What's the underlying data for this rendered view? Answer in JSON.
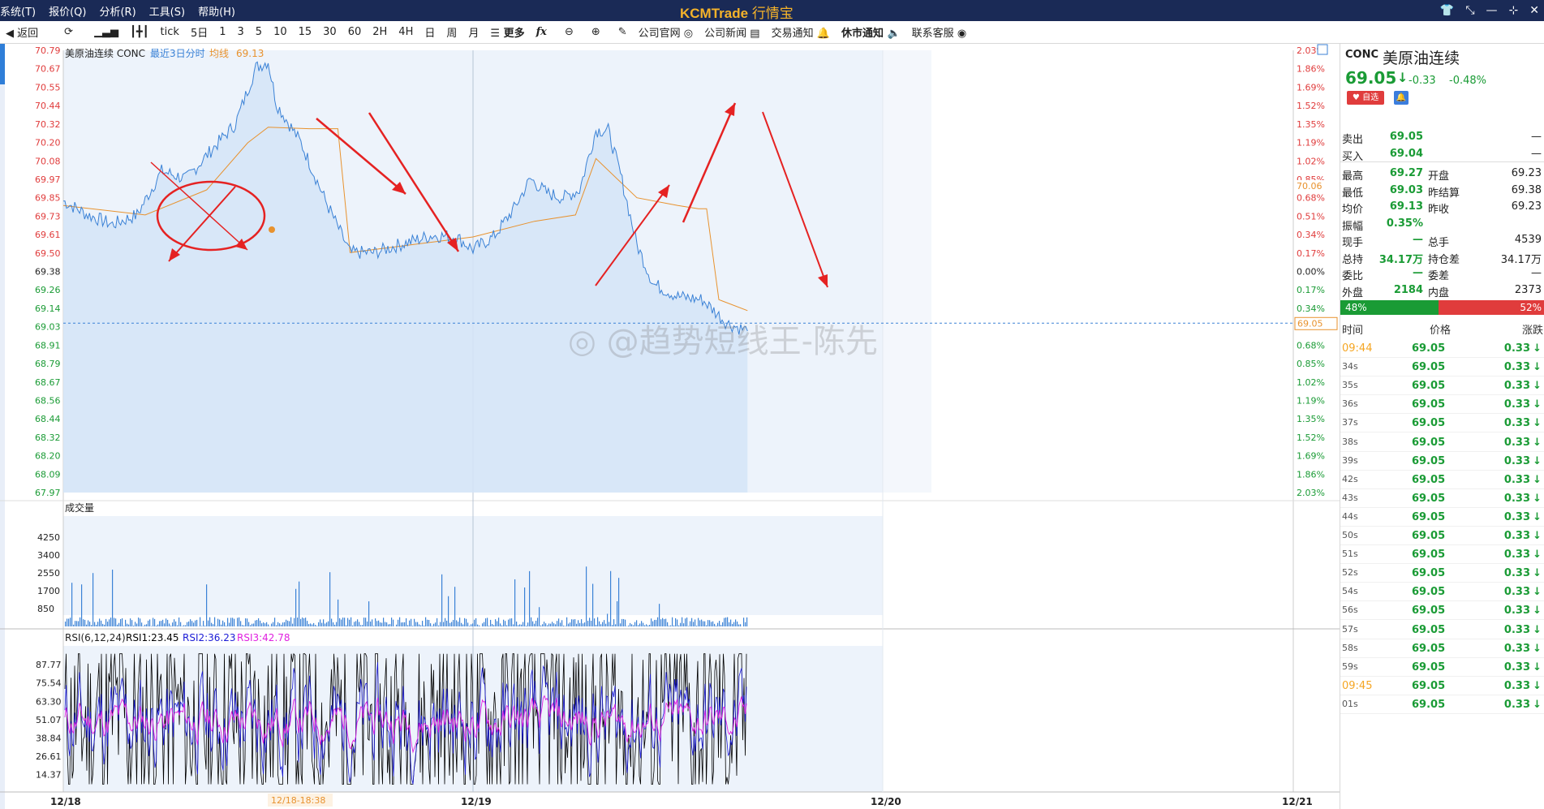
{
  "app": {
    "menu": [
      "系统(T)",
      "报价(Q)",
      "分析(R)",
      "工具(S)",
      "帮助(H)"
    ],
    "brand": "KCMTrade",
    "brand_cn": "行情宝",
    "window_controls": [
      "shirt-icon",
      "shrink-icon",
      "minimize-icon",
      "restore-icon",
      "close-icon"
    ]
  },
  "toolbar": {
    "back": "返回",
    "periods": [
      "tick",
      "5日",
      "1",
      "3",
      "5",
      "10",
      "15",
      "30",
      "60",
      "2H",
      "4H",
      "日",
      "周",
      "月"
    ],
    "more": "更多",
    "links": [
      "公司官网",
      "公司新闻",
      "交易通知",
      "休市通知",
      "联系客服"
    ]
  },
  "chart": {
    "title": "美原油连续 CONC",
    "subtitle": "最近3日分时",
    "avg_label": "均线",
    "avg_value": "69.13",
    "price_ticks": [
      "70.79",
      "70.67",
      "70.55",
      "70.44",
      "70.32",
      "70.20",
      "70.08",
      "69.97",
      "69.85",
      "69.73",
      "69.61",
      "69.50",
      "69.38",
      "69.26",
      "69.14",
      "69.03",
      "68.91",
      "68.79",
      "68.67",
      "68.56",
      "68.44",
      "68.32",
      "68.20",
      "68.09",
      "67.97"
    ],
    "pct_ticks": [
      "2.03%",
      "1.86%",
      "1.69%",
      "1.52%",
      "1.35%",
      "1.19%",
      "1.02%",
      "0.85%",
      "0.68%",
      "0.51%",
      "0.34%",
      "0.17%",
      "0.00%",
      "0.17%",
      "0.34%",
      "0.51%",
      "0.68%",
      "0.85%",
      "1.02%",
      "1.19%",
      "1.35%",
      "1.52%",
      "1.69%",
      "1.86%",
      "2.03%"
    ],
    "avg_right_label": "70.06",
    "current_label": "69.05",
    "volume_title": "成交量",
    "volume_ticks": [
      "4250",
      "3400",
      "2550",
      "1700",
      "850"
    ],
    "rsi_title": "RSI(6,12,24)",
    "rsi1": "RSI1:23.45",
    "rsi2": "RSI2:36.23",
    "rsi3": "RSI3:42.78",
    "rsi_ticks": [
      "87.77",
      "75.54",
      "63.30",
      "51.07",
      "38.84",
      "26.61",
      "14.37"
    ],
    "x_labels": [
      "12/18",
      "12/19",
      "12/20",
      "12/21"
    ],
    "cursor_time": "12/18-18:38",
    "watermark": "@趋势短线王-陈先",
    "colors": {
      "price_line": "#3b82d6",
      "avg_line": "#e8922e",
      "annotation": "#e52222",
      "rsi1": "#000000",
      "rsi2": "#1b1bd6",
      "rsi3": "#e020e0"
    }
  },
  "chart_data": {
    "type": "line",
    "title": "美原油连续 CONC",
    "x_labels": [
      "12/18",
      "12/19",
      "12/20",
      "12/21"
    ],
    "ylim": [
      67.97,
      70.79
    ],
    "prev_settle": 69.38,
    "series": [
      {
        "name": "价格",
        "points": [
          [
            0,
            69.83
          ],
          [
            0.06,
            69.74
          ],
          [
            0.12,
            69.68
          ],
          [
            0.18,
            69.74
          ],
          [
            0.24,
            70.02
          ],
          [
            0.3,
            69.97
          ],
          [
            0.36,
            70.15
          ],
          [
            0.42,
            70.32
          ],
          [
            0.47,
            70.68
          ],
          [
            0.5,
            70.72
          ],
          [
            0.52,
            70.45
          ],
          [
            0.58,
            70.2
          ],
          [
            0.64,
            69.83
          ],
          [
            0.7,
            69.5
          ],
          [
            0.76,
            69.5
          ],
          [
            0.82,
            69.55
          ],
          [
            0.9,
            69.61
          ],
          [
            0.96,
            69.6
          ],
          [
            1.0,
            69.52
          ],
          [
            1.05,
            69.6
          ],
          [
            1.1,
            69.78
          ],
          [
            1.14,
            69.97
          ],
          [
            1.18,
            69.88
          ],
          [
            1.22,
            69.85
          ],
          [
            1.26,
            69.9
          ],
          [
            1.3,
            70.28
          ],
          [
            1.33,
            70.28
          ],
          [
            1.36,
            70.0
          ],
          [
            1.4,
            69.55
          ],
          [
            1.44,
            69.3
          ],
          [
            1.5,
            69.22
          ],
          [
            1.56,
            69.2
          ],
          [
            1.62,
            69.05
          ],
          [
            1.67,
            69.0
          ]
        ]
      },
      {
        "name": "均线",
        "points": [
          [
            0,
            69.8
          ],
          [
            0.2,
            69.74
          ],
          [
            0.35,
            69.9
          ],
          [
            0.45,
            70.2
          ],
          [
            0.5,
            70.3
          ],
          [
            0.6,
            70.29
          ],
          [
            0.67,
            70.29
          ],
          [
            0.7,
            69.5
          ],
          [
            0.85,
            69.55
          ],
          [
            1.0,
            69.6
          ],
          [
            1.15,
            69.7
          ],
          [
            1.25,
            69.74
          ],
          [
            1.3,
            70.1
          ],
          [
            1.4,
            69.85
          ],
          [
            1.5,
            69.8
          ],
          [
            1.55,
            69.78
          ],
          [
            1.57,
            69.78
          ],
          [
            1.6,
            69.2
          ],
          [
            1.67,
            69.13
          ]
        ]
      }
    ],
    "volume_ylim": [
      0,
      5000
    ],
    "rsi_ylim": [
      5,
      97
    ]
  },
  "quote": {
    "code": "CONC",
    "name": "美原油连续",
    "price": "69.05",
    "change": "-0.33",
    "change_pct": "-0.48%",
    "btn_fav": "♥ 自选",
    "rows": [
      {
        "l1": "卖出",
        "v1": "69.05",
        "l2": "",
        "v2": "—"
      },
      {
        "l1": "买入",
        "v1": "69.04",
        "l2": "",
        "v2": "—"
      },
      {
        "l1": "最高",
        "v1": "69.27",
        "l2": "开盘",
        "v2": "69.23"
      },
      {
        "l1": "最低",
        "v1": "69.03",
        "l2": "昨结算",
        "v2": "69.38"
      },
      {
        "l1": "均价",
        "v1": "69.13",
        "l2": "昨收",
        "v2": "69.23"
      },
      {
        "l1": "振幅",
        "v1": "0.35%",
        "l2": "",
        "v2": ""
      },
      {
        "l1": "现手",
        "v1": "—",
        "l2": "总手",
        "v2": "4539"
      },
      {
        "l1": "总持",
        "v1": "34.17万",
        "l2": "持仓差",
        "v2": "34.17万"
      },
      {
        "l1": "委比",
        "v1": "—",
        "l2": "委差",
        "v2": "—"
      },
      {
        "l1": "外盘",
        "v1": "2184",
        "l2": "内盘",
        "v2": "2373"
      }
    ],
    "buy_ratio": "48%",
    "sell_ratio": "52%",
    "buy_fraction": 0.48,
    "ticks_header": [
      "时间",
      "价格",
      "涨跌"
    ],
    "ticks": [
      {
        "t": "09:44",
        "p": "69.05",
        "c": "0.33"
      },
      {
        "t": "34s",
        "p": "69.05",
        "c": "0.33"
      },
      {
        "t": "35s",
        "p": "69.05",
        "c": "0.33"
      },
      {
        "t": "36s",
        "p": "69.05",
        "c": "0.33"
      },
      {
        "t": "37s",
        "p": "69.05",
        "c": "0.33"
      },
      {
        "t": "38s",
        "p": "69.05",
        "c": "0.33"
      },
      {
        "t": "39s",
        "p": "69.05",
        "c": "0.33"
      },
      {
        "t": "42s",
        "p": "69.05",
        "c": "0.33"
      },
      {
        "t": "43s",
        "p": "69.05",
        "c": "0.33"
      },
      {
        "t": "44s",
        "p": "69.05",
        "c": "0.33"
      },
      {
        "t": "50s",
        "p": "69.05",
        "c": "0.33"
      },
      {
        "t": "51s",
        "p": "69.05",
        "c": "0.33"
      },
      {
        "t": "52s",
        "p": "69.05",
        "c": "0.33"
      },
      {
        "t": "54s",
        "p": "69.05",
        "c": "0.33"
      },
      {
        "t": "56s",
        "p": "69.05",
        "c": "0.33"
      },
      {
        "t": "57s",
        "p": "69.05",
        "c": "0.33"
      },
      {
        "t": "58s",
        "p": "69.05",
        "c": "0.33"
      },
      {
        "t": "59s",
        "p": "69.05",
        "c": "0.33"
      },
      {
        "t": "09:45",
        "p": "69.05",
        "c": "0.33"
      },
      {
        "t": "01s",
        "p": "69.05",
        "c": "0.33"
      }
    ]
  }
}
